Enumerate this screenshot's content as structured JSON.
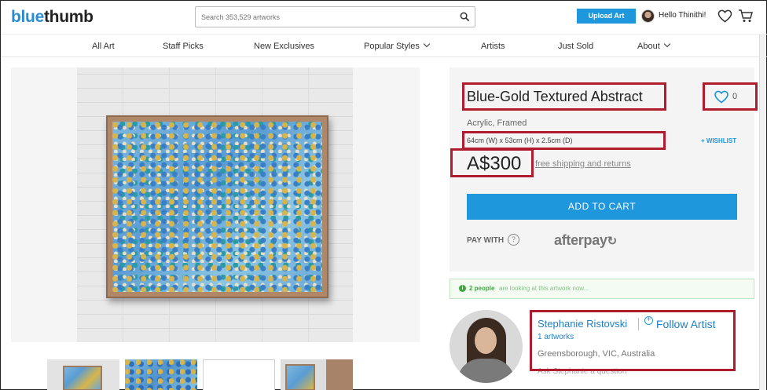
{
  "header": {
    "logo_part1": "blue",
    "logo_part2": "thumb",
    "search_placeholder": "Search 353,529 artworks",
    "upload_label": "Upload Art",
    "greeting": "Hello Thinithi!"
  },
  "nav": {
    "items": [
      "All Art",
      "Staff Picks",
      "New Exclusives",
      "Popular Styles",
      "Artists",
      "Just Sold",
      "About"
    ]
  },
  "artwork": {
    "title": "Blue-Gold Textured Abstract",
    "favorite_count": "0",
    "medium": "Acrylic, Framed",
    "dimensions": "64cm (W) x 53cm (H) x 2.5cm (D)",
    "wishlist_label": "+ WISHLIST",
    "price": "A$300",
    "shipping_link": "free shipping and returns",
    "add_to_cart_label": "ADD TO CART",
    "pay_with_label": "PAY WITH",
    "help_glyph": "?",
    "afterpay_label": "afterpay",
    "afterpay_mark": "↻"
  },
  "viewers": {
    "icon_glyph": "i",
    "count_text": "2 people",
    "rest_text": "are looking at this artwork now..."
  },
  "artist": {
    "name": "Stephanie Ristovski",
    "follow_glyph": "+",
    "follow_label": "Follow Artist",
    "artworks": "1 artworks",
    "location": "Greensborough, VIC, Australia",
    "ask_text": "Ask Stephanie a question"
  },
  "colors": {
    "accent": "#1f97dc",
    "highlight": "#b01c2e",
    "viewers_green": "#3caa3c"
  },
  "icons": [
    "search-icon",
    "heart-icon",
    "cart-icon",
    "question-icon",
    "info-icon",
    "plus-circle-icon",
    "chevron-down-icon"
  ]
}
